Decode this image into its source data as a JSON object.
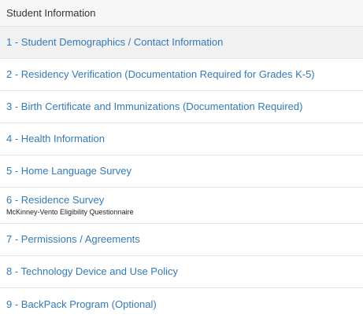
{
  "panel": {
    "title": "Student Information"
  },
  "items": [
    {
      "label": "1 - Student Demographics / Contact Information",
      "active": true
    },
    {
      "label": "2 - Residency Verification (Documentation Required for Grades K-5)"
    },
    {
      "label": "3 - Birth Certificate and Immunizations (Documentation Required)"
    },
    {
      "label": "4 - Health Information"
    },
    {
      "label": "5 - Home Language Survey"
    },
    {
      "label": "6 - Residence Survey",
      "sublabel": "McKinney-Vento Eligibility Questionnaire"
    },
    {
      "label": "7 - Permissions / Agreements"
    },
    {
      "label": "8 - Technology Device and Use Policy"
    },
    {
      "label": "9 - BackPack Program (Optional)"
    }
  ],
  "colors": {
    "link": "#337ab7",
    "header_bg": "#f7f7f7",
    "active_bg": "#f1f1f1",
    "divider": "#e7e7e7"
  }
}
